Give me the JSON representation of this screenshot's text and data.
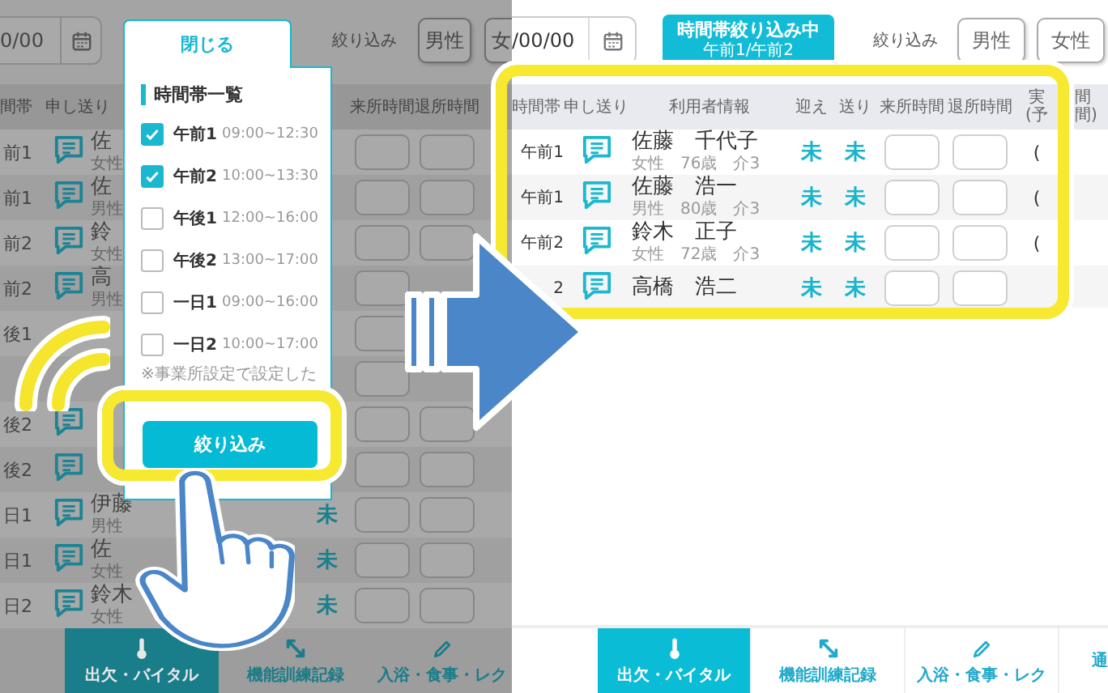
{
  "left_screen": {
    "date_field": "0/00",
    "filter_label": "絞り込み",
    "gender_buttons": [
      "男性",
      "女"
    ],
    "columns": [
      {
        "label": "間帯",
        "kind": "time"
      },
      {
        "label": "申し送り",
        "kind": "memo"
      },
      {
        "label": "来所時間",
        "kind": "arrive"
      },
      {
        "label": "退所時間",
        "kind": "leave"
      }
    ],
    "rows": [
      {
        "time": "前1",
        "memo": true,
        "name": "佐",
        "info": "女性"
      },
      {
        "time": "前1",
        "memo": true,
        "name": "佐",
        "info": "男性"
      },
      {
        "time": "前2",
        "memo": true,
        "name": "鈴",
        "info": "女性"
      },
      {
        "time": "前2",
        "memo": true,
        "name": "高",
        "info": "男性"
      },
      {
        "time": "後1",
        "memo": false
      },
      {
        "memo": false
      },
      {
        "time": "後2",
        "memo": true
      },
      {
        "time": "後2",
        "memo": true
      },
      {
        "time": "日1",
        "memo": true,
        "name": "伊藤",
        "info": "男性",
        "send": "未"
      },
      {
        "time": "日1",
        "memo": true,
        "name": "佐",
        "info": "女性",
        "send": "未"
      },
      {
        "time": "日2",
        "memo": true,
        "name": "鈴木",
        "info": "女性",
        "send": "未"
      }
    ],
    "popup": {
      "close": "閉じる",
      "title": "時間帯一覧",
      "options": [
        {
          "label": "午前1",
          "time": "09:00~12:30",
          "checked": true
        },
        {
          "label": "午前2",
          "time": "10:00~13:30",
          "checked": true
        },
        {
          "label": "午後1",
          "time": "12:00~16:00",
          "checked": false
        },
        {
          "label": "午後2",
          "time": "13:00~17:00",
          "checked": false
        },
        {
          "label": "一日1",
          "time": "09:00~16:00",
          "checked": false
        },
        {
          "label": "一日2",
          "time": "10:00~17:00",
          "checked": false
        }
      ],
      "note": "※事業所設定で設定した",
      "apply_button": "絞り込み"
    },
    "bottom_tabs": [
      {
        "label": "出欠・バイタル",
        "kind": "thermometer",
        "selected": true
      },
      {
        "label": "機能訓練記録",
        "kind": "arrows",
        "selected": false
      },
      {
        "label": "入浴・食事・レク",
        "kind": "pencil",
        "selected": false
      }
    ]
  },
  "right_screen": {
    "date_field": "/00/00",
    "filter_status": {
      "title": "時間帯絞り込み中",
      "detail": "午前1/午前2"
    },
    "filter_label": "絞り込み",
    "gender_buttons": [
      "男性",
      "女性"
    ],
    "columns": [
      "時間帯",
      "申し送り",
      "利用者情報",
      "迎え",
      "送り",
      "来所時間",
      "退所時間",
      "実\n(予",
      "間間)"
    ],
    "rows": [
      {
        "time": "午前1",
        "name": "佐藤　千代子",
        "info": "女性　76歳　介3",
        "pickup": "未",
        "send": "未",
        "column_8": "("
      },
      {
        "time": "午前1",
        "name": "佐藤　浩一",
        "info": "男性　80歳　介3",
        "pickup": "未",
        "send": "未",
        "column_8": "("
      },
      {
        "time": "午前2",
        "name": "鈴木　正子",
        "info": "女性　72歳　介3",
        "pickup": "未",
        "send": "未",
        "column_8": "("
      },
      {
        "time": "2",
        "name": "高橋　浩二",
        "pickup": "未",
        "send": "未"
      }
    ],
    "bottom_tabs": [
      {
        "label": "出欠・バイタル",
        "kind": "thermometer",
        "selected": true
      },
      {
        "label": "機能訓練記録",
        "kind": "arrows",
        "selected": false
      },
      {
        "label": "入浴・食事・レク",
        "kind": "pencil",
        "selected": false
      },
      {
        "label": "通",
        "selected": false
      }
    ]
  }
}
